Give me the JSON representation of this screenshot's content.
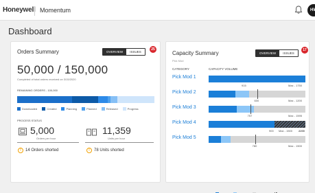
{
  "header": {
    "logo": "Honeywell",
    "app_name": "Momentum",
    "avatar_initials": "HW"
  },
  "page_title": "Dashboard",
  "orders": {
    "title": "Orders Summary",
    "toggle": {
      "overview": "OVERVIEW",
      "issues": "ISSUES"
    },
    "badge": "25",
    "big_number": "50,000 / 150,000",
    "completed_note": "Completed of total orders received on 3/15/2020",
    "remaining_label": "REMAINING ORDERS - 100,000",
    "progress_segments": [
      {
        "name": "Downloaded",
        "fraction": 0.4,
        "color": "#1b6fc9"
      },
      {
        "name": "Created",
        "fraction": 0.19,
        "color": "#0d5aa7"
      },
      {
        "name": "Planning",
        "fraction": 0.07,
        "color": "#2c8ae8"
      },
      {
        "name": "Planned",
        "fraction": 0.02,
        "color": "#4ea1ee"
      },
      {
        "name": "Released",
        "fraction": 0.05,
        "color": "#86bff5"
      },
      {
        "name": "Progress",
        "fraction": 0.27,
        "color": "#cfe5fb"
      }
    ],
    "legend": [
      "Downloaded",
      "Created",
      "Planning",
      "Planned",
      "Released",
      "Progress"
    ],
    "process_status_label": "PROCESS STATUS",
    "orders_per_hour": "5,000",
    "orders_per_hour_unit": "Orders per hour",
    "units_per_hour": "11,359",
    "units_per_hour_unit": "Units per hour",
    "orders_shorted": "14 Orders shorted",
    "units_shorted": "78 Units shorted",
    "icon_orders": "pallet-icon",
    "icon_units": "boxes-icon",
    "icon_warning": "warning-icon"
  },
  "capacity": {
    "title": "Capacity Summary",
    "subtitle": "Pick Mod",
    "toggle": {
      "overview": "OVERVIEW",
      "issues": "ISSUES"
    },
    "badge": "17",
    "col_category": "CATEGORY",
    "col_volume": "CAPACITY VOLUME",
    "modules": [
      {
        "label": "Pick Mod 1",
        "arrived": 1.0,
        "in_transit": 0.0,
        "current_pos": 0.0,
        "current": "915",
        "max": "Max - 1750",
        "over": 0
      },
      {
        "label": "Pick Mod 2",
        "arrived": 0.28,
        "in_transit": 0.14,
        "current_pos": 0.5,
        "current": "600",
        "max": "Max - 1200",
        "over": 0
      },
      {
        "label": "Pick Mod 3",
        "arrived": 0.29,
        "in_transit": 0.18,
        "current_pos": 0.43,
        "current": "757",
        "max": "Max - 1595",
        "over": 0
      },
      {
        "label": "Pick Mod 4",
        "arrived": 0.68,
        "in_transit": 0.0,
        "current_pos": 0.0,
        "current": "900",
        "max": "Max - 1500",
        "max2": "2200",
        "over": 0.32
      },
      {
        "label": "Pick Mod 5",
        "arrived": 0.13,
        "in_transit": 0.1,
        "current_pos": 0.48,
        "current": "780",
        "max": "Max - 1500",
        "over": 0
      }
    ],
    "legend": [
      "Arrived",
      "In transit",
      "Remaining",
      "Over max"
    ],
    "colors": {
      "arrived": "#1b7fd8",
      "in_transit": "#8cc6f7",
      "remaining": "#d6d6d6"
    }
  }
}
